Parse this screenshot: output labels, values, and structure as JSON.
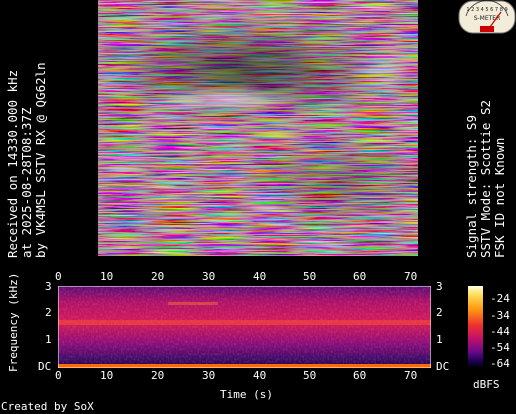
{
  "left_caption": {
    "line1": "Received on  14330.000 kHz",
    "line2": "at 2025-08-28T08:37Z",
    "line3": "by VK4MSL SSTV RX @ QG62ln"
  },
  "right_caption": {
    "line1": "Signal strength: S9",
    "line2": "SSTV Mode: Scottie S2",
    "line3": "FSK ID not Known"
  },
  "meter": {
    "label": "S-METER",
    "scale": "1 2 3 4 5 6 7 8 9"
  },
  "spectrogram": {
    "x_ticks": [
      "0",
      "10",
      "20",
      "30",
      "40",
      "50",
      "60",
      "70"
    ],
    "y_ticks_left": [
      "3",
      "2",
      "1",
      "DC"
    ],
    "y_ticks_right": [
      "3",
      "2",
      "1",
      "DC"
    ],
    "y_title": "Frequency (kHz)",
    "x_title": "Time (s)"
  },
  "colorbar": {
    "ticks": [
      "-24",
      "-34",
      "-44",
      "-54",
      "-64"
    ],
    "unit": "dBFS",
    "colors": [
      "#ffffe0",
      "#ff9a10",
      "#ee3030",
      "#c0106a",
      "#1a0050"
    ]
  },
  "credit": "Created by SoX"
}
